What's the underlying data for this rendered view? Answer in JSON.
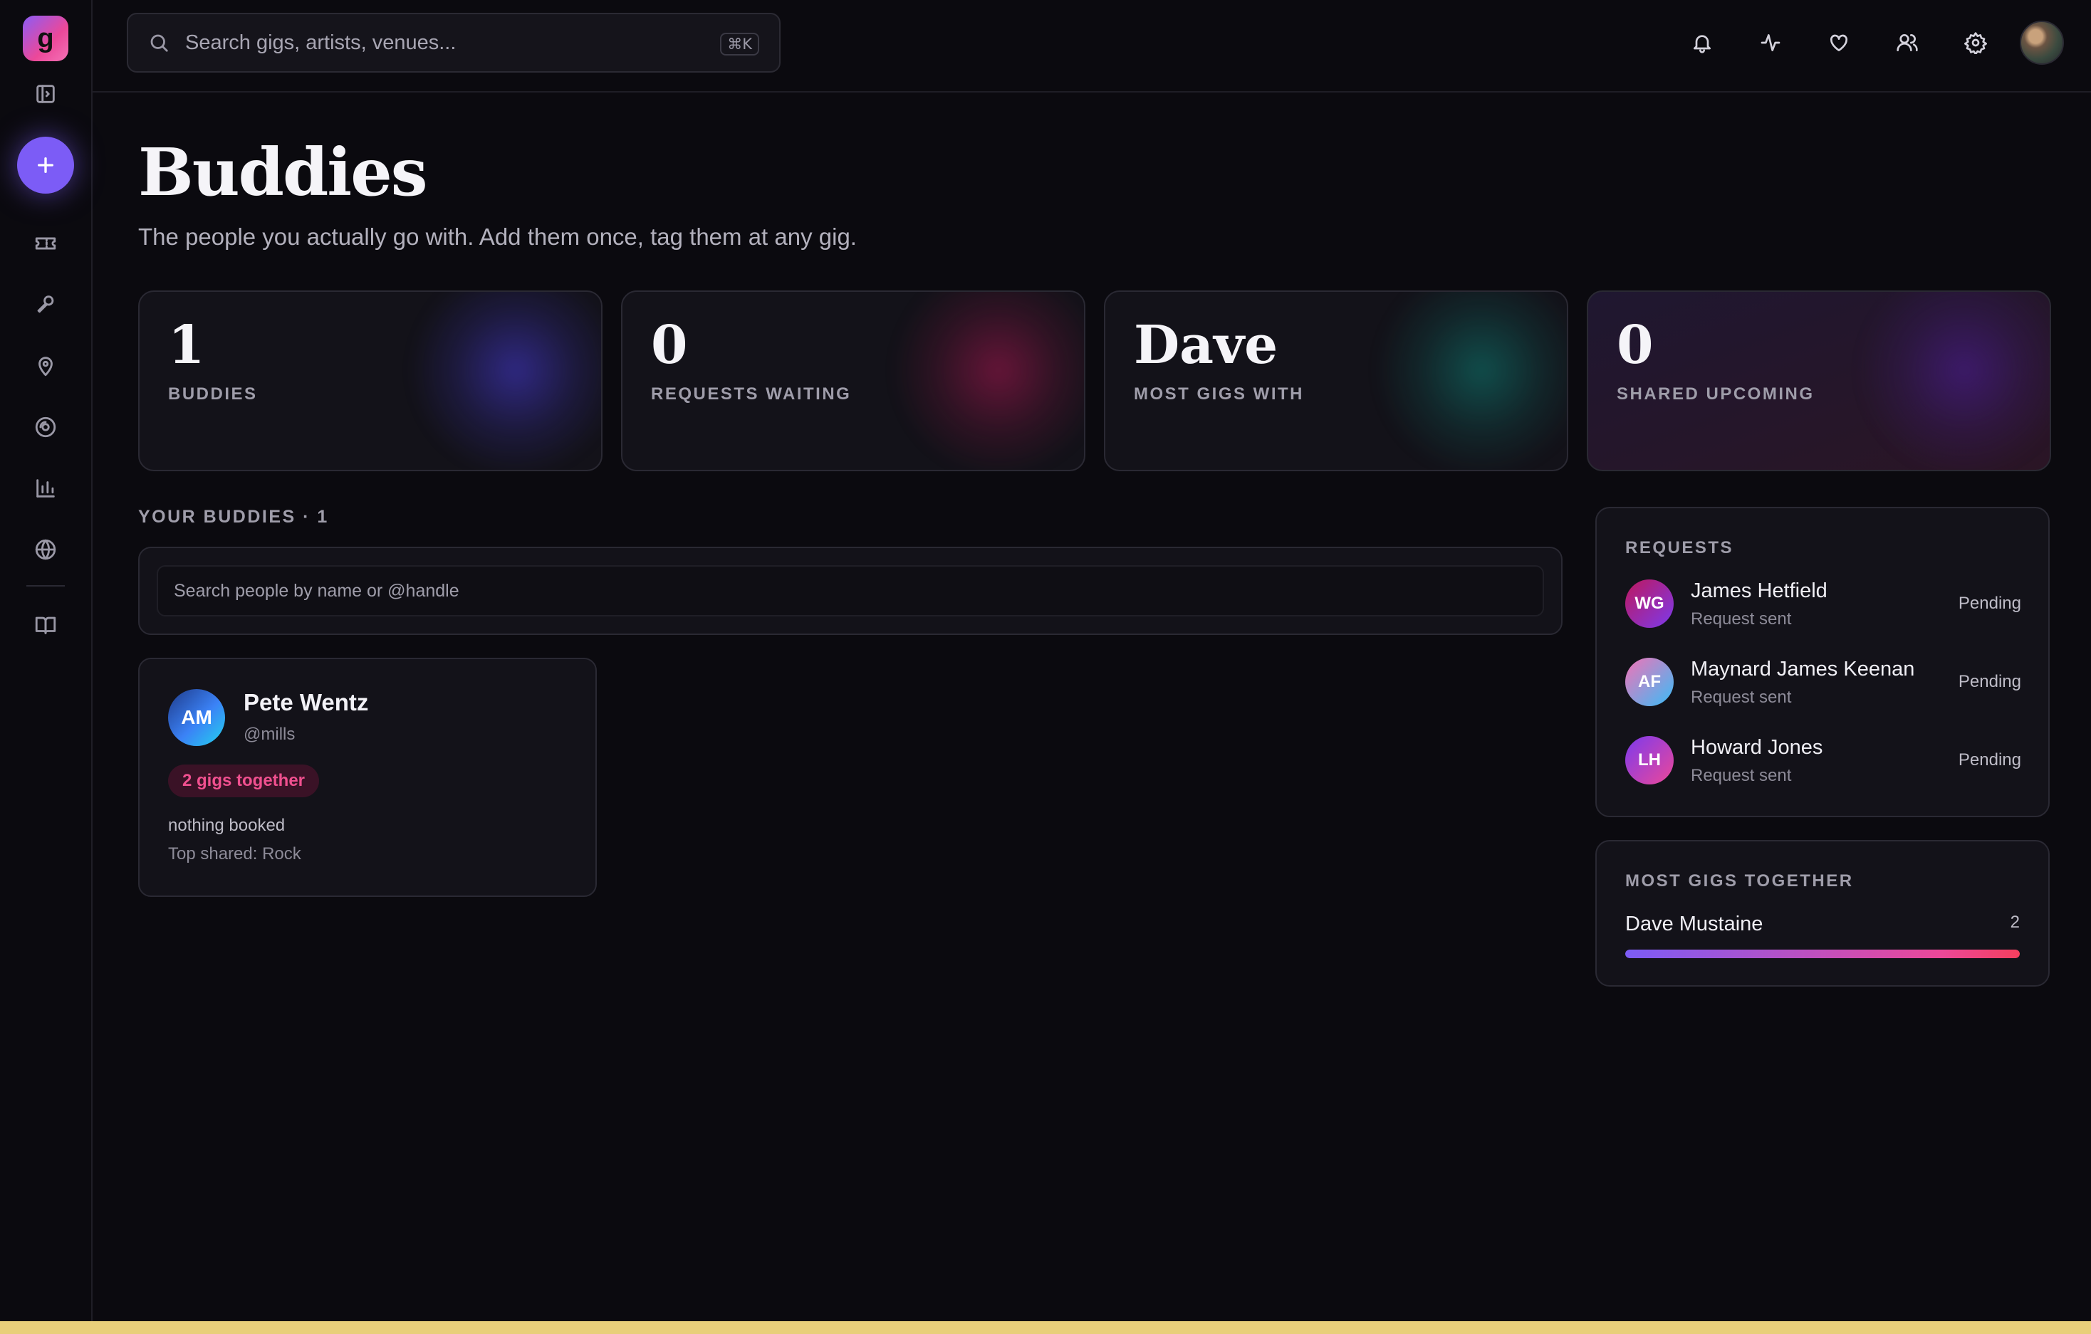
{
  "app": {
    "logo_letter": "g",
    "accent": "#7c5cf6",
    "brand_gradient": [
      "#8b5cf6",
      "#ec4899"
    ]
  },
  "sidebar": {
    "items": [
      {
        "name": "toggle-sidebar",
        "icon": "panel-icon"
      },
      {
        "name": "add",
        "icon": "plus-icon"
      },
      {
        "name": "gigs",
        "icon": "ticket-icon"
      },
      {
        "name": "artists",
        "icon": "microphone-icon"
      },
      {
        "name": "venues",
        "icon": "map-pin-icon"
      },
      {
        "name": "music",
        "icon": "disc-icon"
      },
      {
        "name": "stats",
        "icon": "bar-chart-icon"
      },
      {
        "name": "explore",
        "icon": "globe-icon"
      },
      {
        "name": "guide",
        "icon": "book-icon"
      }
    ]
  },
  "topbar": {
    "search_placeholder": "Search gigs, artists, venues...",
    "shortcut": "⌘K",
    "icons": [
      "bell-icon",
      "activity-icon",
      "heart-icon",
      "users-icon",
      "settings-icon"
    ]
  },
  "page": {
    "title": "Buddies",
    "subtitle": "The people you actually go with. Add them once, tag them at any gig."
  },
  "stats": [
    {
      "value": "1",
      "label": "BUDDIES",
      "glow": "#4338ca"
    },
    {
      "value": "0",
      "label": "REQUESTS WAITING",
      "glow": "#9d174d"
    },
    {
      "value": "Dave",
      "label": "MOST GIGS WITH",
      "glow": "#0f766e"
    },
    {
      "value": "0",
      "label": "SHARED UPCOMING",
      "glow": "#4c1d95"
    }
  ],
  "buddies": {
    "section_label": "YOUR BUDDIES · 1",
    "search_placeholder": "Search people by name or @handle",
    "list": [
      {
        "initials": "AM",
        "name": "Pete Wentz",
        "handle": "@mills",
        "badge": "2 gigs together",
        "line1": "nothing booked",
        "line2": "Top shared: Rock"
      }
    ]
  },
  "requests": {
    "title": "REQUESTS",
    "items": [
      {
        "initials": "WG",
        "name": "James Hetfield",
        "sub": "Request sent",
        "status": "Pending",
        "colors": [
          "#be185d",
          "#7c3aed"
        ]
      },
      {
        "initials": "AF",
        "name": "Maynard James Keenan",
        "sub": "Request sent",
        "status": "Pending",
        "colors": [
          "#f472b6",
          "#38bdf8"
        ]
      },
      {
        "initials": "LH",
        "name": "Howard Jones",
        "sub": "Request sent",
        "status": "Pending",
        "colors": [
          "#7c3aed",
          "#ec4899"
        ]
      }
    ]
  },
  "most_gigs": {
    "title": "MOST GIGS TOGETHER",
    "items": [
      {
        "name": "Dave Mustaine",
        "count": "2",
        "fraction": 1.0
      }
    ]
  }
}
